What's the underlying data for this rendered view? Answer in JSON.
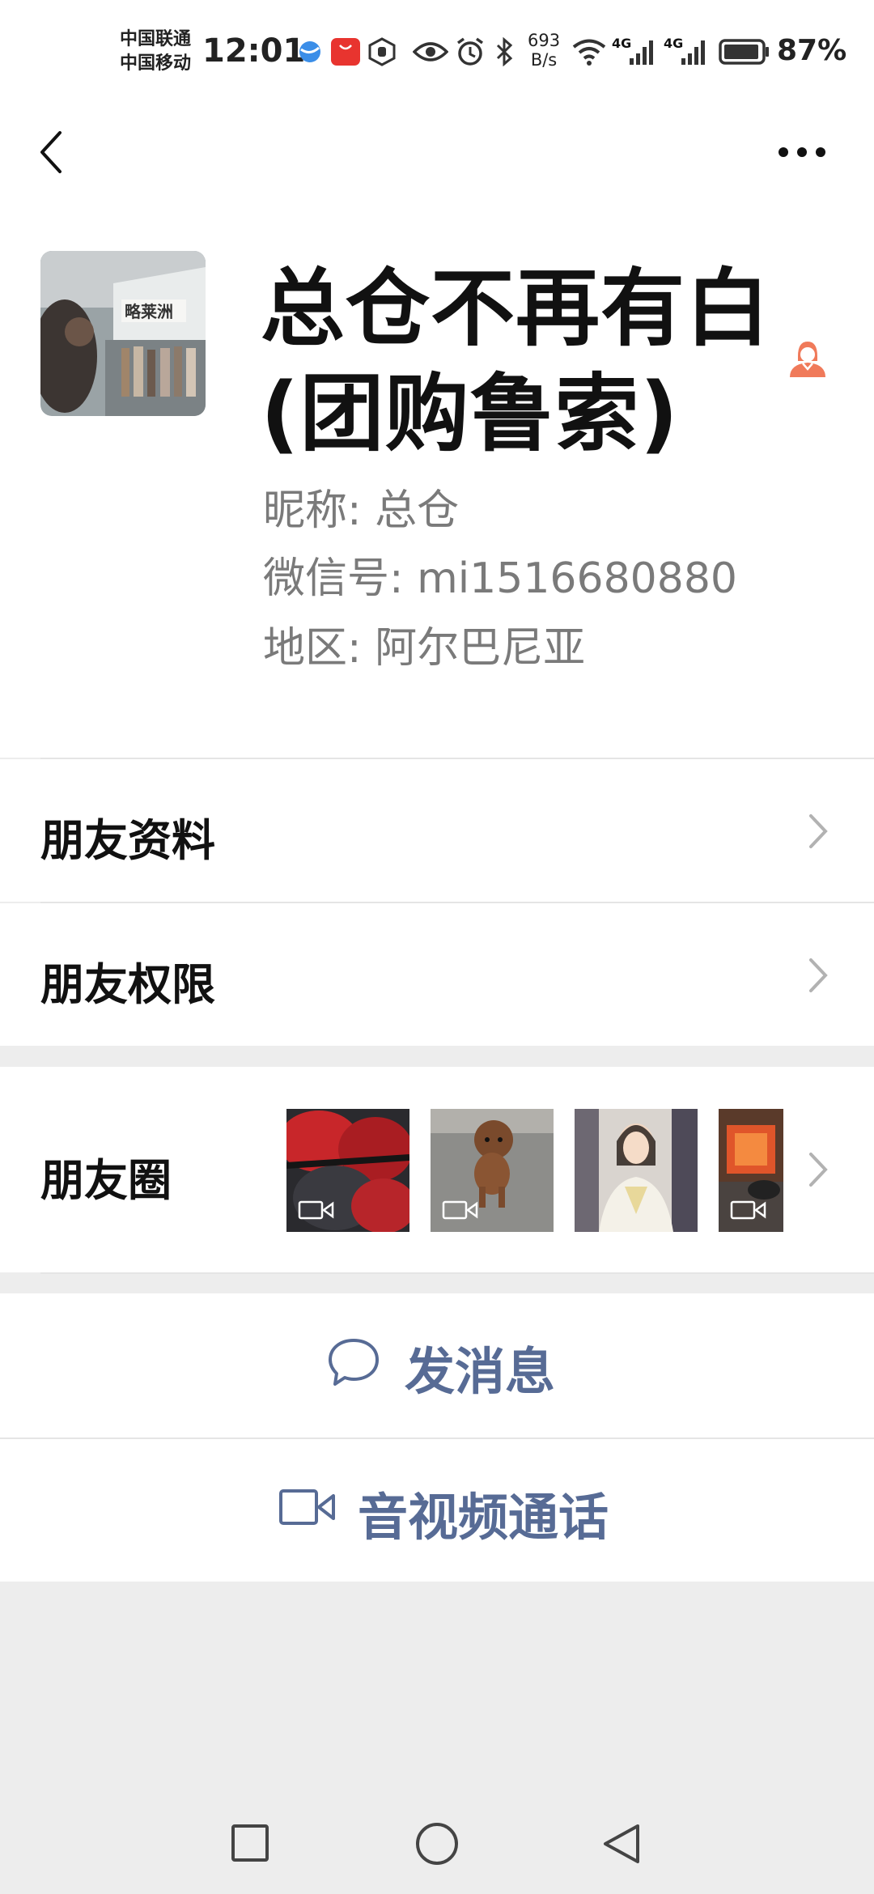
{
  "status_bar": {
    "carrier_1": "中国联通",
    "carrier_2": "中国移动",
    "time": "12:01",
    "net_speed_value": "693",
    "net_speed_unit": "B/s",
    "signal_1_label": "4G",
    "signal_2_label": "4G",
    "battery_percent": "87%",
    "icons": [
      "browser-icon",
      "huawei-store-icon",
      "hand-shield-icon",
      "eye-icon",
      "alarm-icon",
      "bluetooth-icon",
      "wifi-icon",
      "signal-icon",
      "battery-icon"
    ]
  },
  "nav": {
    "back_icon": "chevron-left-icon",
    "more_icon": "more-dots-icon"
  },
  "profile": {
    "display_name_line1": "总仓不再有白",
    "display_name_line2": "(团购鲁索)",
    "nickname_label": "昵称:",
    "nickname_value": "总仓",
    "wechat_id_label": "微信号:",
    "wechat_id_value": "mi1516680880",
    "region_label": "地区:",
    "region_value": "阿尔巴尼亚",
    "avatar_sign_text": "略莱洲"
  },
  "menu": {
    "friend_info": "朋友资料",
    "friend_permissions": "朋友权限",
    "moments": "朋友圈"
  },
  "actions": {
    "send_message": "发消息",
    "video_call": "音视频通话"
  },
  "colors": {
    "link_blue": "#576b95",
    "gender_female": "#f07a5a",
    "background": "#ededed"
  },
  "bottom_nav": [
    "square-recent-apps-icon",
    "circle-home-icon",
    "triangle-back-icon"
  ]
}
